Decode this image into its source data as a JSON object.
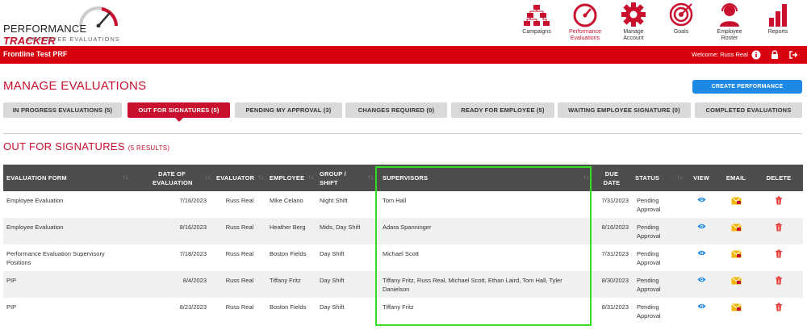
{
  "app": {
    "logo_title_part1": "PERFORMANCE ",
    "logo_title_part2": "TRACKER",
    "logo_subtitle": "EMPLOYEE EVALUATIONS"
  },
  "nav": [
    {
      "label": "Campaigns",
      "icon": "org-chart-icon"
    },
    {
      "label": "Performance Evaluations",
      "icon": "speedometer-icon"
    },
    {
      "label": "Manage Account",
      "icon": "gear-icon"
    },
    {
      "label": "Goals",
      "icon": "target-icon"
    },
    {
      "label": "Employee Roster",
      "icon": "headset-user-icon"
    },
    {
      "label": "Reports",
      "icon": "bar-chart-icon"
    }
  ],
  "redbar": {
    "prf": "Frontline Test PRF",
    "welcome": "Welcome: Russ Real"
  },
  "page": {
    "title": "MANAGE EVALUATIONS",
    "create_button": "CREATE PERFORMANCE EVALUATION"
  },
  "tabs": [
    "IN PROGRESS EVALUATIONS (5)",
    "OUT FOR SIGNATURES (5)",
    "PENDING MY APPROVAL (3)",
    "CHANGES REQUIRED (0)",
    "READY FOR EMPLOYEE (5)",
    "WAITING EMPLOYEE SIGNATURE (0)",
    "COMPLETED EVALUATIONS"
  ],
  "section": {
    "title": "OUT FOR SIGNATURES",
    "count": "(5 RESULTS)"
  },
  "table": {
    "headers": {
      "form": "EVALUATION FORM",
      "date": "DATE OF EVALUATION",
      "evaluator": "EVALUATOR",
      "employee": "EMPLOYEE",
      "group": "GROUP / SHIFT",
      "supervisors": "SUPERVISORS",
      "due": "DUE DATE",
      "status": "STATUS",
      "view": "VIEW",
      "email": "EMAIL",
      "delete": "DELETE"
    },
    "rows": [
      {
        "form": "Employee Evaluation",
        "date": "7/16/2023",
        "evaluator": "Russ Real",
        "employee": "Mike Celano",
        "group": "Night Shift",
        "supervisors": "Tom Hall",
        "due": "7/31/2023",
        "status": "Pending Approval"
      },
      {
        "form": "Employee Evaluation",
        "date": "8/16/2023",
        "evaluator": "Russ Real",
        "employee": "Heather Berg",
        "group": "Mids, Day Shift",
        "supervisors": "Adara Spanninger",
        "due": "8/16/2023",
        "status": "Pending Approval"
      },
      {
        "form": "Performance Evaluation Supervisory Positions",
        "date": "7/18/2023",
        "evaluator": "Russ Real",
        "employee": "Boston Fields",
        "group": "Day Shift",
        "supervisors": "Michael Scott",
        "due": "7/31/2023",
        "status": "Pending Approval"
      },
      {
        "form": "PIP",
        "date": "8/4/2023",
        "evaluator": "Russ Real",
        "employee": "Tiffany Fritz",
        "group": "Day Shift",
        "supervisors": "Tiffany Fritz, Russ Real, Michael Scott, Ethan Laird, Tom Hall, Tyler Danielson",
        "due": "8/30/2023",
        "status": "Pending Approval"
      },
      {
        "form": "PIP",
        "date": "8/23/2023",
        "evaluator": "Russ Real",
        "employee": "Boston Fields",
        "group": "Day Shift",
        "supervisors": "Tiffany Fritz",
        "due": "8/31/2023",
        "status": "Pending Approval"
      }
    ]
  },
  "colors": {
    "brand_red": "#c8102e",
    "bar_red": "#d7000f",
    "button_blue": "#1e88e5",
    "highlight_green": "#33dd22"
  }
}
